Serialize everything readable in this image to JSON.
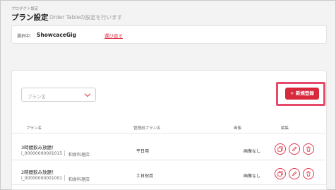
{
  "header": {
    "breadcrumb": "プロダクト設定",
    "title": "プラン設定",
    "subtitle": "Order Tableの設定を行います"
  },
  "selection": {
    "label": "選択中：",
    "name": "ShowcaceGig",
    "link": "選び直す"
  },
  "filter": {
    "placeholder": "プラン名"
  },
  "actions": {
    "new_button": "+ 新規登録"
  },
  "table": {
    "columns": [
      "プラン名",
      "管理用プラン名",
      "画像",
      "編集"
    ],
    "rows": [
      {
        "name": "3時間飲み放題！",
        "id": "i_00000000001015",
        "category": "和食料理店",
        "management_name": "平日用",
        "image": "画像なし"
      },
      {
        "name": "2時間飲み放題！",
        "id": "i_00000000001001",
        "category": "和食料理店",
        "management_name": "土日祝用",
        "image": "画像なし"
      }
    ]
  },
  "colors": {
    "accent": "#d8283c",
    "highlight": "#e64a6a"
  },
  "icons": [
    "chevron-down-icon",
    "copy-icon",
    "edit-icon",
    "trash-icon"
  ]
}
